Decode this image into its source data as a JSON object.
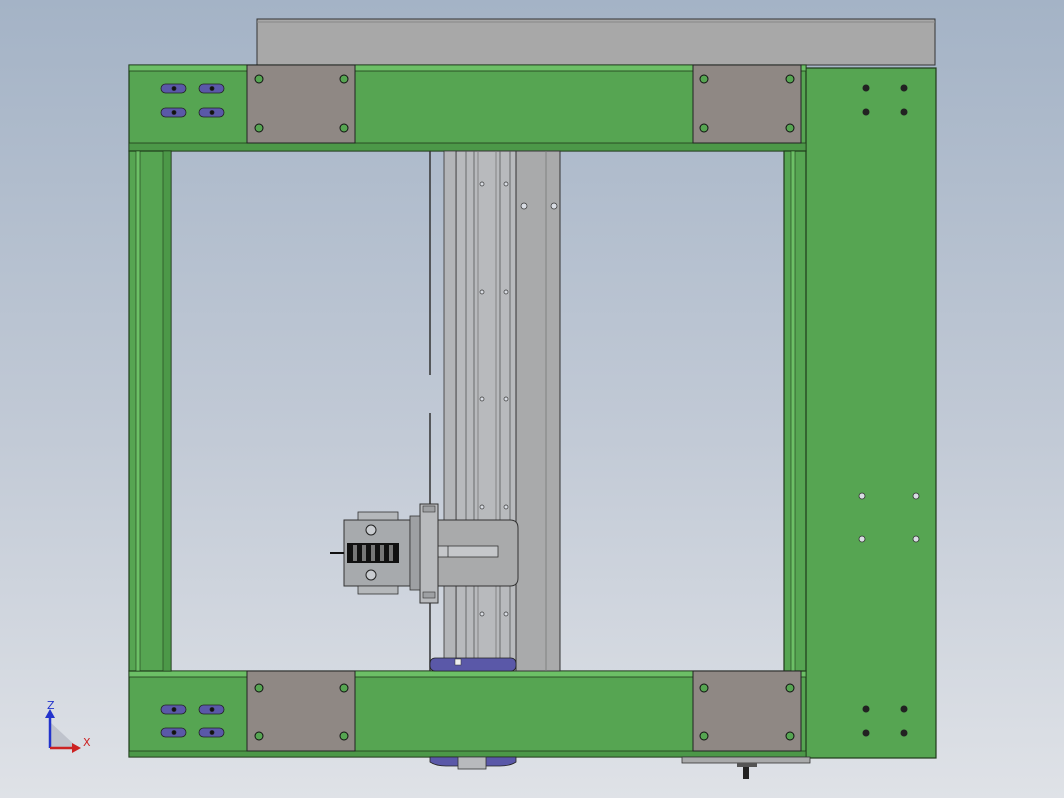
{
  "viewport": {
    "background_top": "#a4b3c6",
    "background_bottom": "#dfe2e7"
  },
  "colors": {
    "frame_green": "#56a552",
    "frame_green_light": "#6cc066",
    "frame_edge": "#1e3a1a",
    "bracket_gray": "#8f8884",
    "rail_gray": "#a9aaab",
    "slot_blue": "#5a58a8",
    "axis_z": "#2233cc",
    "axis_x": "#cc2222"
  },
  "triad": {
    "z_label": "Z",
    "x_label": "X",
    "z_icon": "z-axis-arrow-icon",
    "x_icon": "x-axis-arrow-icon"
  }
}
